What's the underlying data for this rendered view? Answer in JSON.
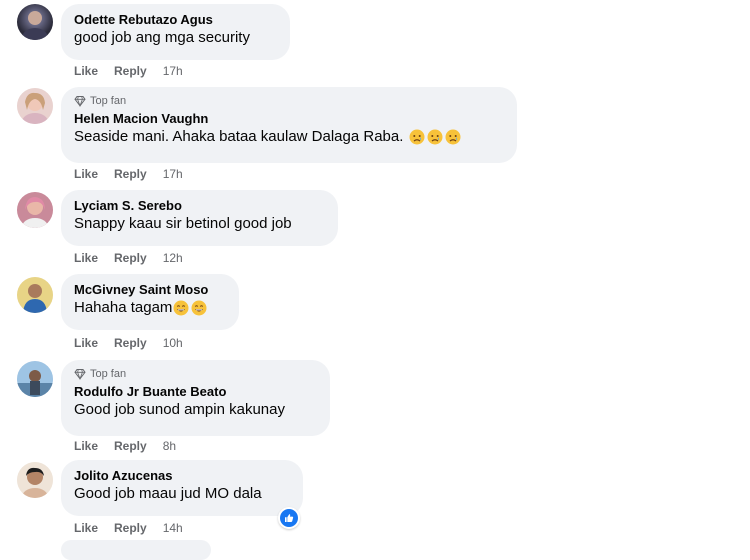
{
  "colors": {
    "bubble": "#f0f2f5",
    "meta": "#65676b",
    "like_blue": "#1877f2"
  },
  "comments": [
    {
      "name": "Odette Rebutazo Agus",
      "badge": "",
      "text": "good job ang mga security",
      "emojis": "",
      "like": "Like",
      "reply": "Reply",
      "time": "17h"
    },
    {
      "name": "Helen Macion Vaughn",
      "badge": "Top fan",
      "text": "Seaside mani. Ahaka bataa kaulaw Dalaga Raba.",
      "emojis": "sad-face sad-face sad-face",
      "like": "Like",
      "reply": "Reply",
      "time": "17h"
    },
    {
      "name": "Lyciam S. Serebo",
      "badge": "",
      "text": "Snappy kaau sir betinol good job",
      "emojis": "",
      "like": "Like",
      "reply": "Reply",
      "time": "12h"
    },
    {
      "name": "McGivney Saint Moso",
      "badge": "",
      "text": "Hahaha tagam",
      "emojis": "grin-face grin-face",
      "like": "Like",
      "reply": "Reply",
      "time": "10h"
    },
    {
      "name": "Rodulfo Jr Buante Beato",
      "badge": "Top fan",
      "text": "Good job sunod ampin kakunay",
      "emojis": "",
      "like": "Like",
      "reply": "Reply",
      "time": "8h"
    },
    {
      "name": "Jolito Azucenas",
      "badge": "",
      "text": "Good job maau jud MO dala",
      "emojis": "",
      "like": "Like",
      "reply": "Reply",
      "time": "14h",
      "reaction": "like-reaction-icon"
    }
  ]
}
